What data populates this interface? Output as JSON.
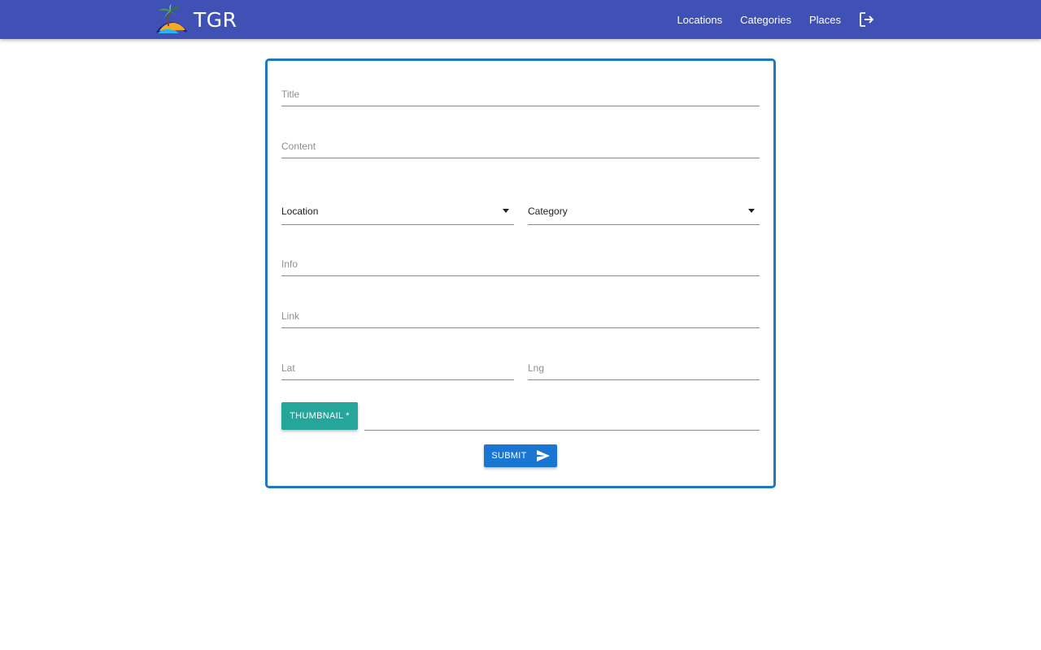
{
  "brand": {
    "name": "TGR",
    "logo_icon": "palm-island-logo-icon"
  },
  "nav": {
    "items": [
      {
        "label": "Locations"
      },
      {
        "label": "Categories"
      },
      {
        "label": "Places"
      }
    ],
    "logout_icon": "logout-icon"
  },
  "form": {
    "title": {
      "placeholder": "Title",
      "value": ""
    },
    "content": {
      "placeholder": "Content",
      "value": ""
    },
    "location": {
      "selected": "Location"
    },
    "category": {
      "selected": "Category"
    },
    "info": {
      "placeholder": "Info",
      "value": ""
    },
    "link": {
      "placeholder": "Link",
      "value": ""
    },
    "lat": {
      "placeholder": "Lat",
      "value": ""
    },
    "lng": {
      "placeholder": "Lng",
      "value": ""
    },
    "thumbnail_label": "THUMBNAIL *",
    "thumbnail_path": "",
    "submit_label": "SUBMIT",
    "submit_icon": "send-icon"
  },
  "colors": {
    "navbar": "#3f51b5",
    "card_border": "#1e78c2",
    "thumbnail_button": "#26a69a",
    "submit_button": "#1976d2"
  }
}
